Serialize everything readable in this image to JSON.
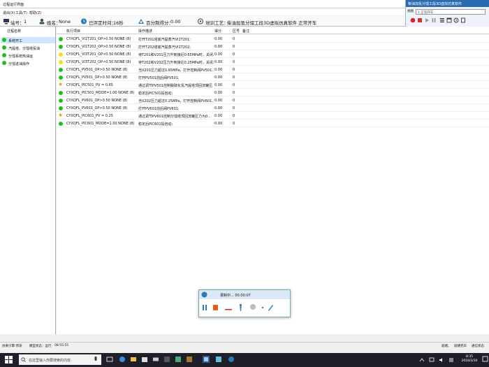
{
  "window": {
    "title": "过程运行界面"
  },
  "menu": [
    "退出(X)",
    "工具(T)",
    "帮助(Z)"
  ],
  "info": {
    "station_label": "站号：",
    "station": "1",
    "name_label": "姓名：",
    "name": "None",
    "elapsed_label": "已评定时间：",
    "elapsed": "16秒",
    "score_label": "百分制得分：",
    "score": "0.00",
    "process_label": "培训工艺：",
    "process": "柴油加氢分馏工段3D虚拟仿真软件 正常开车"
  },
  "right_panel": {
    "title": "柴油加氢分馏工段3D虚拟仿真软件",
    "select_label": "视图",
    "select_value": "1.正常开车"
  },
  "left_pane": {
    "header": "过程名称",
    "items": [
      "系统开工",
      "汽提塔、分馏塔投油",
      "分馏系统热油运",
      "分馏进油操作"
    ]
  },
  "grid": {
    "headers": [
      "执行项目",
      "操作描述",
      "得分",
      "区号",
      "备注"
    ],
    "rows": [
      {
        "status": "green",
        "item": "CYXQFL_VI1T201_OP>0.50  NONE  (8)",
        "desc": "打开T201塔底汽提蒸汽VI1T201;",
        "score": "0.00",
        "zone": "0"
      },
      {
        "status": "green",
        "item": "CYXQFL_VI1T202_OP>0.50  NONE  (8)",
        "desc": "打开T202塔底汽提蒸汽VI1T202;",
        "score": "0.00",
        "zone": "0"
      },
      {
        "status": "yellow",
        "item": "CYXQFL_VI3T201_OP<0.50  NONE  (8)",
        "desc": "待T201和V201压力升到接近0.65MPa时，关闭...",
        "score": "0.00",
        "zone": "0"
      },
      {
        "status": "yellow",
        "item": "CYXQFL_VI3T202_OP<0.50  NONE  (8)",
        "desc": "待T202和V202压力升到接近0.25MPa时，关闭...",
        "score": "0.00",
        "zone": "0"
      },
      {
        "status": "green",
        "item": "CYXQFL_PV501_OP>0.50  NONE  (8)",
        "desc": "当V201压力超过0.65MPa，打开控制阀PV501...",
        "score": "0.00",
        "zone": "0"
      },
      {
        "status": "green",
        "item": "CYXQFL_PV501_OP>0.50  NONE  (8)",
        "desc": "打开PV501前后阀PV501;",
        "score": "0.00",
        "zone": "0"
      },
      {
        "status": "star",
        "item": "CYXQFL_PIC501_PV = 0.65",
        "desc": "通过调节PV501控制脱硫化氢汽提塔顶回流罐压...",
        "score": "0.00",
        "zone": "0"
      },
      {
        "status": "green",
        "item": "CYXQFL_PIC501_MODE=1.00  NONE  (8)",
        "desc": "稳定后PIC501投自动;",
        "score": "0.00",
        "zone": "0"
      },
      {
        "status": "green",
        "item": "CYXQFL_PV601_OP>0.50  NONE  (8)",
        "desc": "当V202压力超过0.25MPa，打开控制阀PV601...",
        "score": "0.00",
        "zone": "0"
      },
      {
        "status": "green",
        "item": "CYXQFL_PV601_OP>0.50  NONE  (8)",
        "desc": "打开PV601前后阀PV601;",
        "score": "0.00",
        "zone": "0"
      },
      {
        "status": "star",
        "item": "CYXQFL_PIC601_PV = 0.25",
        "desc": "通过调节PV601控制分馏塔顶回流罐压力为0...",
        "score": "0.00",
        "zone": "0"
      },
      {
        "status": "green",
        "item": "CYXQFL_PIC601_MODE=1.00  NONE  (8)",
        "desc": "稳定后PIC601投自动;",
        "score": "0.00",
        "zone": "0"
      }
    ]
  },
  "status_bar": {
    "left": "仿真引擎:停滞",
    "mode": "模型状态：运行",
    "time": "08:55:55",
    "right": "就绪。",
    "right2": "就绪完毕",
    "right3": "通信状态"
  },
  "recorder": {
    "label": "录制中... 00:00:07"
  },
  "taskbar": {
    "search_placeholder": "在这里输入你要搜索的内容",
    "time": "8:35",
    "date": "2018/3/30"
  },
  "colors": {
    "green": "#1fbf1f",
    "yellow": "#f0e020",
    "star": "#e0a000",
    "accent": "#2b6cb0"
  }
}
